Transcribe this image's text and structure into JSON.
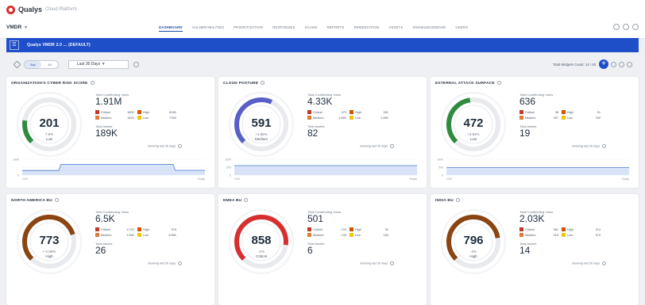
{
  "app": {
    "brand": "Qualys",
    "brand_sub": "Cloud Platform",
    "module": "VMDR"
  },
  "nav": {
    "tabs": [
      {
        "label": "DASHBOARD",
        "active": true
      },
      {
        "label": "VULNERABILITIES",
        "active": false
      },
      {
        "label": "PRIORITIZATION",
        "active": false
      },
      {
        "label": "RESPONSES",
        "active": false
      },
      {
        "label": "SCANS",
        "active": false
      },
      {
        "label": "REPORTS",
        "active": false
      },
      {
        "label": "REMEDIATION",
        "active": false
      },
      {
        "label": "ASSETS",
        "active": false
      },
      {
        "label": "KNOWLEDGEBASE",
        "active": false
      },
      {
        "label": "USERS",
        "active": false
      }
    ]
  },
  "dashboard": {
    "title": "Qualys VMDR 2.0 ... (DEFAULT)",
    "toggle": [
      "Asc",
      "All"
    ],
    "date_range": "Last 30 Days",
    "widget_count": "Total Widgets Count: 14 / 40",
    "add_label": "+"
  },
  "colors": {
    "accent": "#1f4fc8",
    "critical": "#c0392b",
    "medium": "#e07b39",
    "high": "#d35400",
    "low": "#f1c40f",
    "gauge_low": "#2e8b3e",
    "gauge_medium": "#5a5fc8",
    "gauge_high": "#8b4513",
    "gauge_critical": "#d62f2f"
  },
  "cards": [
    {
      "title": "ORGANIZATION'S CYBER RISK SCORE",
      "score": "201",
      "pct": "7.9%",
      "level": "Low",
      "gauge_fraction": 0.2,
      "gauge_color": "#2e8b3e",
      "total_contributing_label": "Total Contributing Vulns",
      "total_contributing": "1.91M",
      "severity": [
        {
          "label": "Critical",
          "value": "180K",
          "color": "#c0392b"
        },
        {
          "label": "High",
          "value": "815K",
          "color": "#d35400"
        },
        {
          "label": "Medium",
          "value": "181K",
          "color": "#e07b39"
        },
        {
          "label": "Low",
          "value": "778K",
          "color": "#f1c40f"
        }
      ],
      "total_assets_label": "Total Assets",
      "total_assets": "189K",
      "showing": "showing last 30 days",
      "trend": {
        "y_top": "1000",
        "y_bottom": "0",
        "x_start": "10/3",
        "x_end": "Today",
        "values": [
          290,
          290,
          290,
          290,
          290,
          290,
          290,
          290,
          290,
          290,
          290,
          290,
          290,
          290,
          290,
          290,
          290,
          680,
          680,
          680,
          680,
          680,
          680,
          680,
          680,
          680,
          680,
          680,
          680,
          680,
          680,
          680,
          680,
          680,
          680,
          680,
          680,
          680,
          680,
          680,
          680,
          680,
          680,
          680,
          680,
          680,
          680,
          680,
          680,
          680,
          680,
          680,
          680,
          680,
          680,
          680,
          680,
          680,
          680,
          680,
          680,
          680,
          680,
          680,
          680,
          680,
          680,
          300,
          300,
          300,
          300,
          300,
          300,
          300,
          300,
          300,
          300,
          300,
          300,
          300,
          300
        ]
      }
    },
    {
      "title": "CLOUD POSTURE",
      "score": "591",
      "pct": "+1.55%",
      "level": "Medium",
      "gauge_fraction": 0.59,
      "gauge_color": "#5a5fc8",
      "total_contributing_label": "Total Contributing Vulns",
      "total_contributing": "4.33K",
      "severity": [
        {
          "label": "Critical",
          "value": "473",
          "color": "#c0392b"
        },
        {
          "label": "High",
          "value": "951",
          "color": "#d35400"
        },
        {
          "label": "Medium",
          "value": "1.46K",
          "color": "#e07b39"
        },
        {
          "label": "Low",
          "value": "1.45K",
          "color": "#f1c40f"
        }
      ],
      "total_assets_label": "Total Assets",
      "total_assets": "82",
      "showing": "showing last 30 days",
      "trend": {
        "y_top": "1000",
        "y_mid": "500",
        "y_bottom": "0",
        "x_start": "10/3",
        "x_end": "Today",
        "values": [
          590,
          595,
          600,
          600,
          600,
          600,
          600,
          600,
          600,
          600,
          600,
          600,
          600,
          600,
          600,
          600,
          600,
          600,
          600,
          600,
          600,
          600,
          600,
          600,
          600,
          600,
          600,
          600,
          600,
          600,
          600,
          600,
          600,
          600,
          600,
          600,
          600,
          600,
          600,
          600,
          600,
          600,
          600,
          600,
          600,
          600,
          600,
          600,
          600,
          600,
          600,
          600,
          600,
          600,
          600,
          600,
          600,
          600,
          600,
          600,
          600,
          600,
          600,
          600,
          600,
          600,
          600,
          600,
          600,
          600,
          600,
          600,
          600,
          600,
          600,
          600,
          600,
          600,
          600,
          600,
          590
        ]
      }
    },
    {
      "title": "EXTERNAL ATTACK SURFACE",
      "score": "472",
      "pct": "+3.64%",
      "level": "Low",
      "gauge_fraction": 0.47,
      "gauge_color": "#2e8b3e",
      "total_contributing_label": "Total Contributing Vulns",
      "total_contributing": "636",
      "severity": [
        {
          "label": "Critical",
          "value": "38",
          "color": "#c0392b"
        },
        {
          "label": "High",
          "value": "51",
          "color": "#d35400"
        },
        {
          "label": "Medium",
          "value": "257",
          "color": "#e07b39"
        },
        {
          "label": "Low",
          "value": "290",
          "color": "#f1c40f"
        }
      ],
      "total_assets_label": "Total Assets",
      "total_assets": "19",
      "showing": "showing last 30 days",
      "trend": {
        "y_top": "1000",
        "y_mid": "500",
        "y_bottom": "0",
        "x_start": "10/3",
        "x_end": "Today",
        "values": [
          470,
          470,
          470,
          470,
          470,
          470,
          470,
          470,
          470,
          470,
          470,
          470,
          470,
          470,
          470,
          470,
          470,
          470,
          470,
          470,
          470,
          470,
          470,
          470,
          470,
          470,
          470,
          470,
          470,
          470,
          470,
          470,
          470,
          470,
          470,
          470,
          470,
          470,
          470,
          470,
          470,
          470,
          470,
          470,
          470,
          470,
          470,
          470,
          470,
          470,
          470,
          470,
          470,
          470,
          470,
          470,
          470,
          470,
          470,
          470,
          470,
          470,
          470,
          470,
          470,
          470,
          470,
          470,
          470,
          470,
          470,
          470,
          470,
          470,
          470,
          470,
          470,
          470,
          470,
          470,
          470
        ]
      }
    },
    {
      "title": "NORTH AMERICA BU",
      "score": "773",
      "pct": "+ 0.90%",
      "level": "High",
      "gauge_fraction": 0.77,
      "gauge_color": "#8b4513",
      "total_contributing_label": "Total Contributing Vulns",
      "total_contributing": "6.5K",
      "severity": [
        {
          "label": "Critical",
          "value": "1.07K",
          "color": "#c0392b"
        },
        {
          "label": "High",
          "value": "976",
          "color": "#d35400"
        },
        {
          "label": "Medium",
          "value": "1.36K",
          "color": "#e07b39"
        },
        {
          "label": "Low",
          "value": "3.08K",
          "color": "#f1c40f"
        }
      ],
      "total_assets_label": "Total Assets",
      "total_assets": "26",
      "showing": "showing last 30 days"
    },
    {
      "title": "EMEA BU",
      "score": "858",
      "pct": "-1%",
      "level": "Critical",
      "gauge_fraction": 0.86,
      "gauge_color": "#d62f2f",
      "total_contributing_label": "Total Contributing Vulns",
      "total_contributing": "501",
      "severity": [
        {
          "label": "Critical",
          "value": "124",
          "color": "#c0392b"
        },
        {
          "label": "High",
          "value": "92",
          "color": "#d35400"
        },
        {
          "label": "Medium",
          "value": "135",
          "color": "#e07b39"
        },
        {
          "label": "Low",
          "value": "150",
          "color": "#f1c40f"
        }
      ],
      "total_assets_label": "Total Assets",
      "total_assets": "6",
      "showing": "showing last 30 days"
    },
    {
      "title": "INDIA BU",
      "score": "796",
      "pct": "-3%",
      "level": "High",
      "gauge_fraction": 0.8,
      "gauge_color": "#8b4513",
      "total_contributing_label": "Total Contributing Vulns",
      "total_contributing": "2.03K",
      "severity": [
        {
          "label": "Critical",
          "value": "361",
          "color": "#c0392b"
        },
        {
          "label": "High",
          "value": "374",
          "color": "#d35400"
        },
        {
          "label": "Medium",
          "value": "315",
          "color": "#e07b39"
        },
        {
          "label": "Low",
          "value": "979",
          "color": "#f1c40f"
        }
      ],
      "total_assets_label": "Total Assets",
      "total_assets": "14",
      "showing": "showing last 30 days"
    }
  ]
}
